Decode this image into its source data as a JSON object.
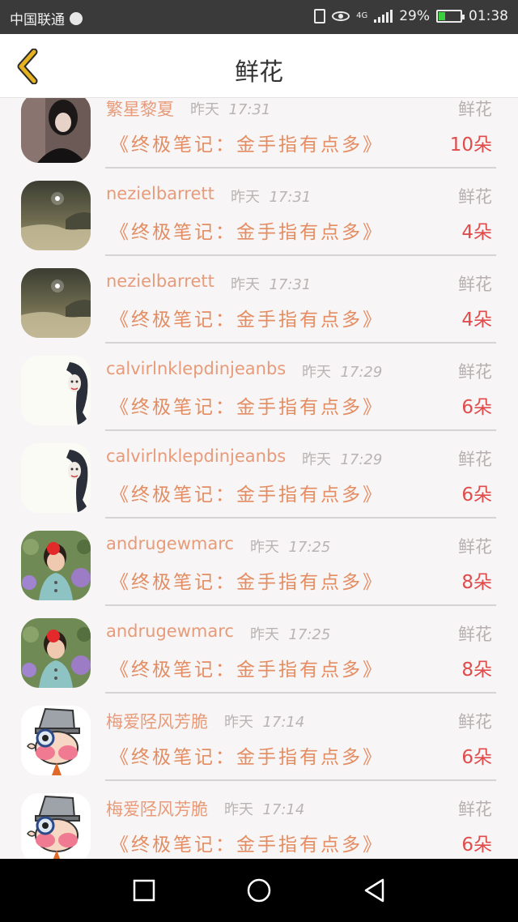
{
  "status_bar": {
    "carrier": "中国联通",
    "network": "4G",
    "battery": "29%",
    "battery_level": 0.29,
    "time": "01:38"
  },
  "header": {
    "title": "鲜花"
  },
  "list": {
    "items": [
      {
        "name": "繁星黎夏",
        "day": "昨天",
        "time": "17:31",
        "gift": "鲜花",
        "book": "《终极笔记：金手指有点多》",
        "count": "10朵",
        "avatar": "dark-portrait"
      },
      {
        "name": "nezielbarrett",
        "day": "昨天",
        "time": "17:31",
        "gift": "鲜花",
        "book": "《终极笔记：金手指有点多》",
        "count": "4朵",
        "avatar": "moon-sea"
      },
      {
        "name": "nezielbarrett",
        "day": "昨天",
        "time": "17:31",
        "gift": "鲜花",
        "book": "《终极笔记：金手指有点多》",
        "count": "4朵",
        "avatar": "moon-sea"
      },
      {
        "name": "calvirlnklepdinjeanbs",
        "day": "昨天",
        "time": "17:29",
        "gift": "鲜花",
        "book": "《终极笔记：金手指有点多》",
        "count": "6朵",
        "avatar": "sketch-girl"
      },
      {
        "name": "calvirlnklepdinjeanbs",
        "day": "昨天",
        "time": "17:29",
        "gift": "鲜花",
        "book": "《终极笔记：金手指有点多》",
        "count": "6朵",
        "avatar": "sketch-girl"
      },
      {
        "name": "andrugewmarc",
        "day": "昨天",
        "time": "17:25",
        "gift": "鲜花",
        "book": "《终极笔记：金手指有点多》",
        "count": "8朵",
        "avatar": "kid-flowers"
      },
      {
        "name": "andrugewmarc",
        "day": "昨天",
        "time": "17:25",
        "gift": "鲜花",
        "book": "《终极笔记：金手指有点多》",
        "count": "8朵",
        "avatar": "kid-flowers"
      },
      {
        "name": "梅爱陉风芳脆",
        "day": "昨天",
        "time": "17:14",
        "gift": "鲜花",
        "book": "《终极笔记：金手指有点多》",
        "count": "6朵",
        "avatar": "cartoon-detective"
      },
      {
        "name": "梅爱陉风芳脆",
        "day": "昨天",
        "time": "17:14",
        "gift": "鲜花",
        "book": "《终极笔记：金手指有点多》",
        "count": "6朵",
        "avatar": "cartoon-detective"
      }
    ]
  },
  "nav_bar": {
    "recent_icon": "square-icon",
    "home_icon": "circle-icon",
    "back_icon": "triangle-back-icon"
  },
  "colors": {
    "accent_name": "#e79b7a",
    "book": "#e48d63",
    "count": "#e04b4b",
    "back_arrow": "#e6b21f"
  }
}
